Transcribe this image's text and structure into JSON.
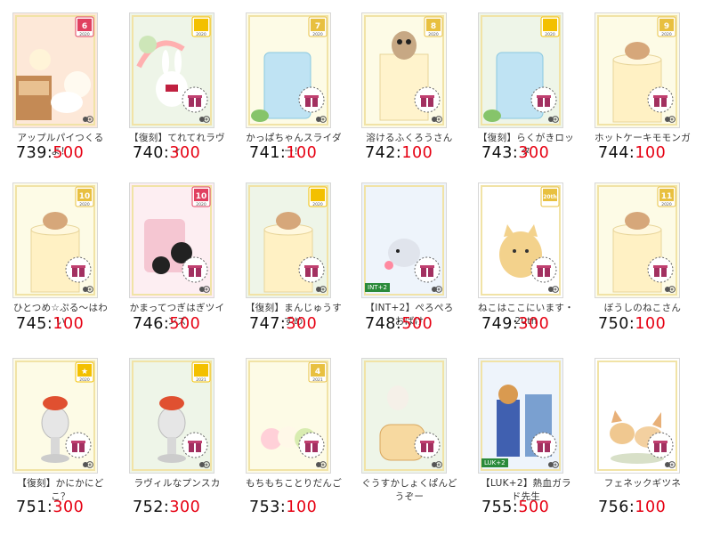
{
  "items": [
    {
      "title": "アップルパイつくるよ！",
      "id": "739",
      "price": "500",
      "badge": "6",
      "badge_color": "#e04060",
      "badge_year": "2020",
      "bg": "#fde8d8",
      "theme": "kitchen"
    },
    {
      "title": "【復刻】てれてれラヴィ",
      "id": "740",
      "price": "300",
      "badge": "",
      "badge_color": "#f3c000",
      "badge_year": "2020",
      "bg": "#eef5e8",
      "theme": "bunny"
    },
    {
      "title": "かっぱちゃんスライダー！",
      "id": "741",
      "price": "100",
      "badge": "7",
      "badge_color": "#e8c040",
      "badge_year": "2020",
      "bg": "#fdfbe6",
      "theme": "glass"
    },
    {
      "title": "溶けるふくろうさん",
      "id": "742",
      "price": "100",
      "badge": "8",
      "badge_color": "#e8c040",
      "badge_year": "2020",
      "bg": "#fdfbe6",
      "theme": "owl"
    },
    {
      "title": "【復刻】らくがきロッタ",
      "id": "743",
      "price": "300",
      "badge": "",
      "badge_color": "#f3c000",
      "badge_year": "2020",
      "bg": "#eef5e8",
      "theme": "glass"
    },
    {
      "title": "ホットケーキモモンガ",
      "id": "744",
      "price": "100",
      "badge": "9",
      "badge_color": "#e8c040",
      "badge_year": "2020",
      "bg": "#fdfbe6",
      "theme": "cup"
    },
    {
      "title": "ひとつめ☆ぷる～はわい",
      "id": "745",
      "price": "100",
      "badge": "10",
      "badge_color": "#e8c040",
      "badge_year": "2020",
      "bg": "#fdfbe6",
      "theme": "cup"
    },
    {
      "title": "かまってつぎはぎツインズ",
      "id": "746",
      "price": "500",
      "badge": "10",
      "badge_color": "#e04060",
      "badge_year": "2020",
      "bg": "#fdeef2",
      "theme": "pink"
    },
    {
      "title": "【復刻】まんじゅうすずめ",
      "id": "747",
      "price": "300",
      "badge": "",
      "badge_color": "#f3c000",
      "badge_year": "2020",
      "bg": "#eef5e8",
      "theme": "cup"
    },
    {
      "title": "【INT+2】ぺろぺろおばけ",
      "id": "748",
      "price": "500",
      "badge": "",
      "badge_color": "#b07840",
      "badge_year": "",
      "bg": "#eef4fb",
      "theme": "ghost",
      "tag": "INT+2"
    },
    {
      "title": "ねこはここにいます・20th",
      "id": "749",
      "price": "300",
      "badge": "20th",
      "badge_color": "#e8c040",
      "badge_year": "",
      "bg": "#ffffff",
      "theme": "cat"
    },
    {
      "title": "ぼうしのねこさん",
      "id": "750",
      "price": "100",
      "badge": "11",
      "badge_color": "#e8c040",
      "badge_year": "2020",
      "bg": "#fdfbe6",
      "theme": "cup"
    },
    {
      "title": "【復刻】かにかにどこ？",
      "id": "751",
      "price": "300",
      "badge": "★",
      "badge_color": "#f3c000",
      "badge_year": "2020",
      "bg": "#fdfbe6",
      "theme": "stand"
    },
    {
      "title": "ラヴィルなプンスカ",
      "id": "752",
      "price": "300",
      "badge": "",
      "badge_color": "#f3c000",
      "badge_year": "2021",
      "bg": "#eef5e8",
      "theme": "stand"
    },
    {
      "title": "もちもちことりだんご",
      "id": "753",
      "price": "100",
      "badge": "4",
      "badge_color": "#e8c040",
      "badge_year": "2021",
      "bg": "#fdfbe6",
      "theme": "birds"
    },
    {
      "title": "ぐうすかしょくぱんどうぞー",
      "id": "",
      "price": "",
      "badge": "",
      "badge_color": "#f3c000",
      "badge_year": "",
      "bg": "#eef5e8",
      "theme": "bread"
    },
    {
      "title": "【LUK+2】熱血ガラド先生",
      "id": "755",
      "price": "500",
      "badge": "",
      "badge_color": "#b07840",
      "badge_year": "",
      "bg": "#eef4fb",
      "theme": "tiger",
      "tag": "LUK+2"
    },
    {
      "title": "フェネックギツネ",
      "id": "756",
      "price": "100",
      "badge": "",
      "badge_color": "",
      "badge_year": "",
      "bg": "#ffffff",
      "theme": "fox"
    }
  ],
  "separator": ":"
}
